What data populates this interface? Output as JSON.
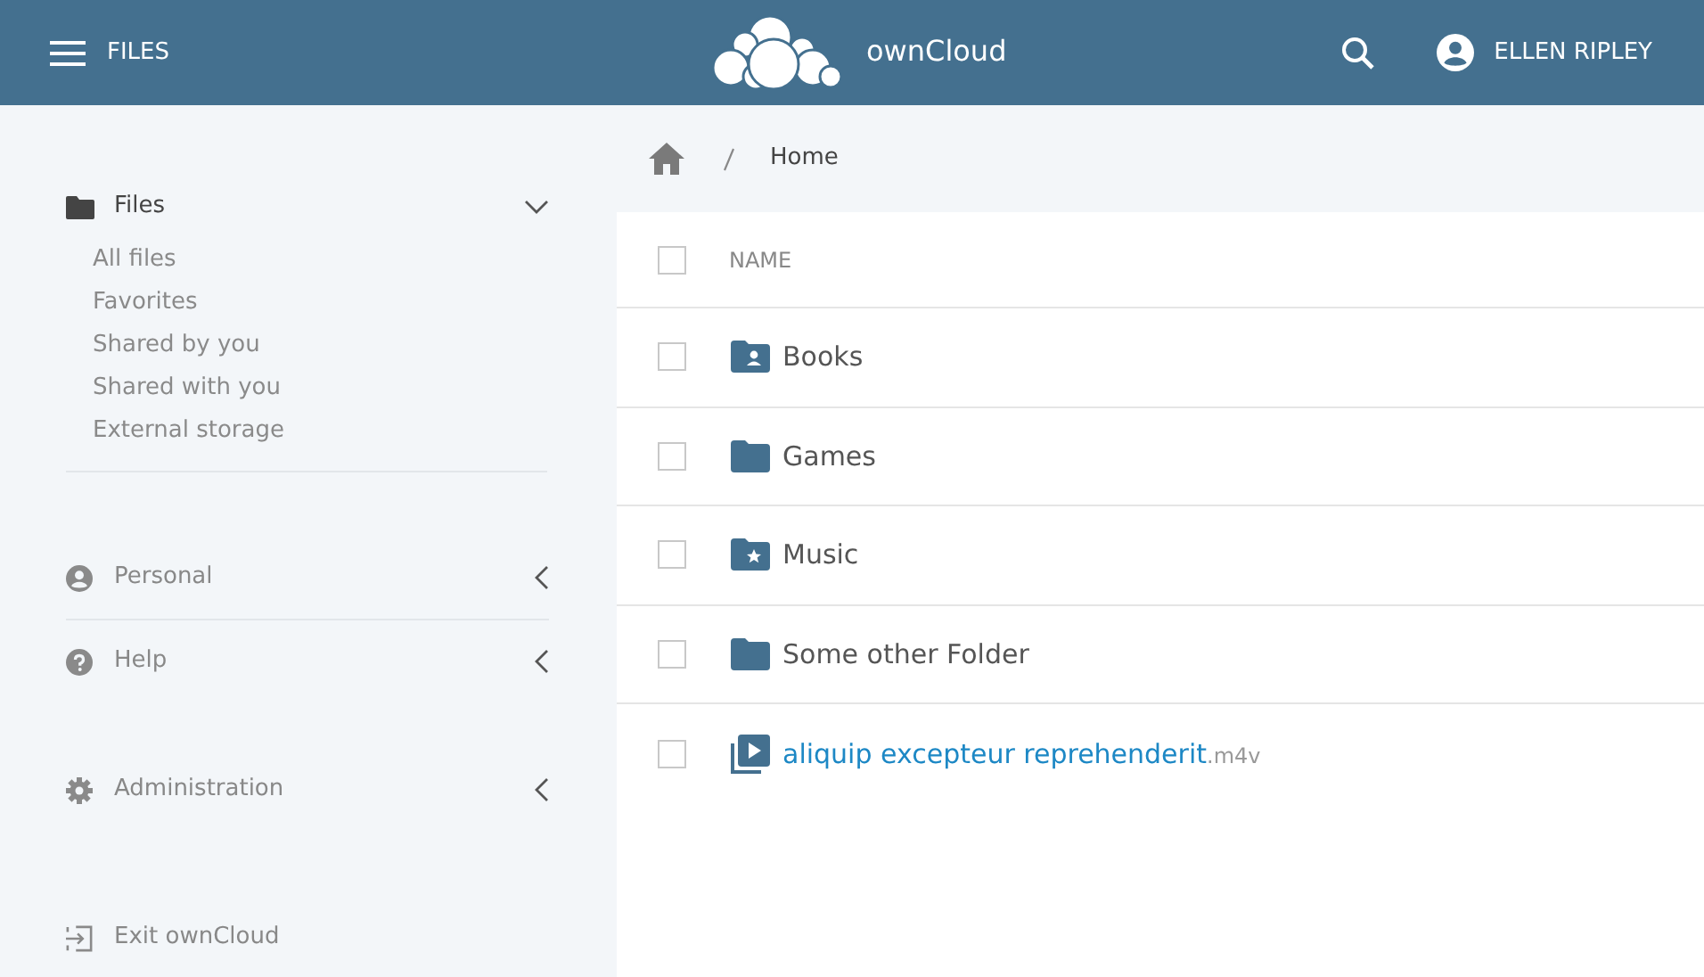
{
  "header": {
    "app_label": "FILES",
    "brand": "ownCloud",
    "user": "ELLEN RIPLEY"
  },
  "sidebar": {
    "sections": [
      {
        "kind": "files",
        "label": "Files",
        "expanded": true,
        "items": [
          "All files",
          "Favorites",
          "Shared by you",
          "Shared with you",
          "External storage"
        ]
      },
      {
        "kind": "personal",
        "label": "Personal",
        "expanded": false
      },
      {
        "kind": "help",
        "label": "Help",
        "expanded": false
      },
      {
        "kind": "admin",
        "label": "Administration",
        "expanded": false
      }
    ],
    "exit": "Exit ownCloud"
  },
  "breadcrumb": [
    "Home"
  ],
  "table": {
    "columns": [
      "NAME"
    ],
    "select_all": {
      "checked": false
    },
    "rows": [
      {
        "kind": "shared-folder",
        "name": "Books",
        "checked": false
      },
      {
        "kind": "folder",
        "name": "Games",
        "checked": false
      },
      {
        "kind": "starred-folder",
        "name": "Music",
        "checked": false
      },
      {
        "kind": "folder",
        "name": "Some other Folder",
        "checked": false
      },
      {
        "kind": "video",
        "name": "aliquip excepteur reprehenderit",
        "extension": ".m4v",
        "checked": false
      }
    ]
  }
}
